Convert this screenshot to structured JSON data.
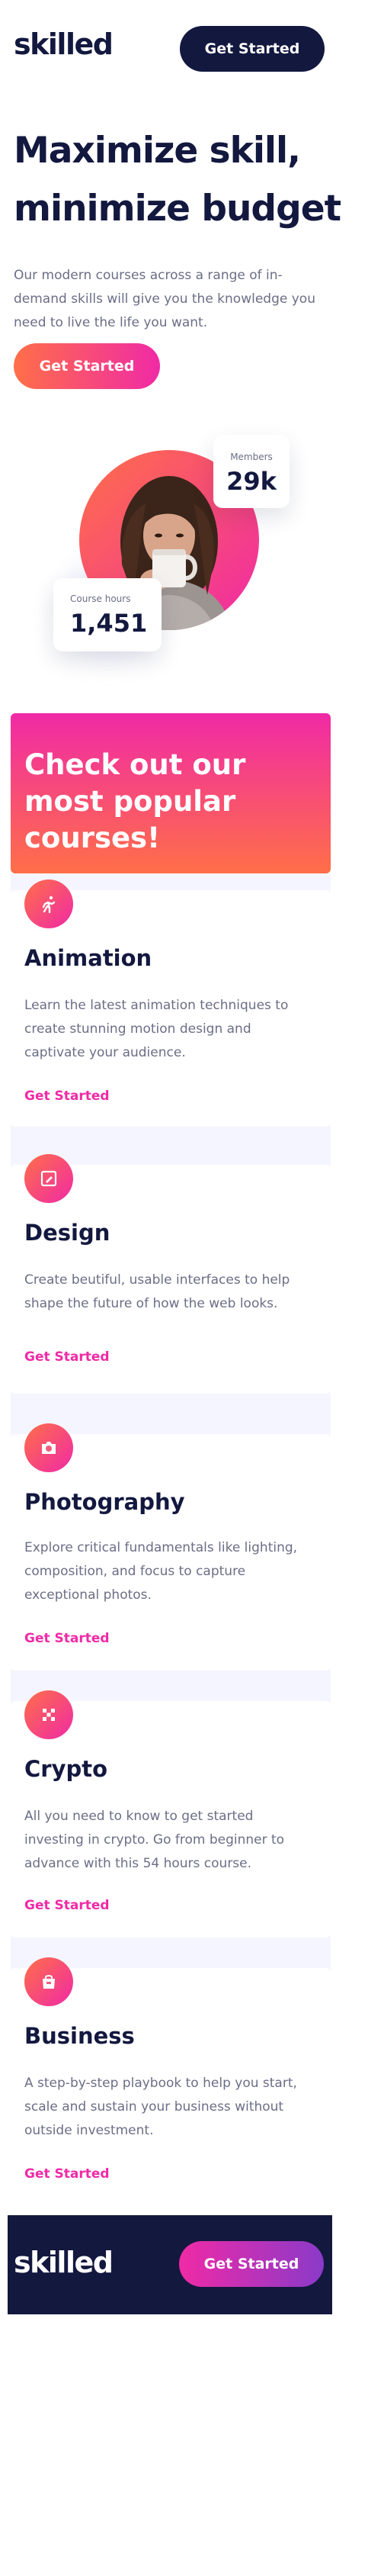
{
  "header": {
    "logo": "skilled",
    "cta_label": "Get Started"
  },
  "hero": {
    "title": "Maximize skill, minimize budget",
    "text": "Our modern courses across a range of in-demand skills will give you the knowledge you need to live the life you want.",
    "cta_label": "Get Started"
  },
  "stats": {
    "members": {
      "label": "Members",
      "value": "29k"
    },
    "course_hours": {
      "label": "Course hours",
      "value": "1,451"
    }
  },
  "courses": {
    "heading": "Check out our most popular courses!",
    "items": [
      {
        "icon": "animation-runner-icon",
        "title": "Animation",
        "text": "Learn the latest animation techniques to create stunning motion design and captivate your audience.",
        "link": "Get Started"
      },
      {
        "icon": "design-pen-icon",
        "title": "Design",
        "text": "Create beutiful, usable interfaces to help shape the future of how the web looks.",
        "link": "Get Started"
      },
      {
        "icon": "camera-icon",
        "title": "Photography",
        "text": "Explore critical fundamentals like lighting, composition, and focus to capture exceptional photos.",
        "link": "Get Started"
      },
      {
        "icon": "crypto-icon",
        "title": "Crypto",
        "text": "All you need to know to get started investing in crypto. Go from beginner to advance with this 54 hours course.",
        "link": "Get Started"
      },
      {
        "icon": "business-bag-icon",
        "title": "Business",
        "text": "A step-by-step playbook to help you start, scale and sustain your business without outside investment.",
        "link": "Get Started"
      }
    ]
  },
  "footer": {
    "logo": "skilled",
    "cta_label": "Get Started"
  },
  "colors": {
    "navy": "#13183f",
    "pink": "#f02aa6",
    "orange": "#ff6f48",
    "purple": "#8a3ac9",
    "text_gray": "#6b6e86",
    "band_bg": "#f5f5ff"
  }
}
